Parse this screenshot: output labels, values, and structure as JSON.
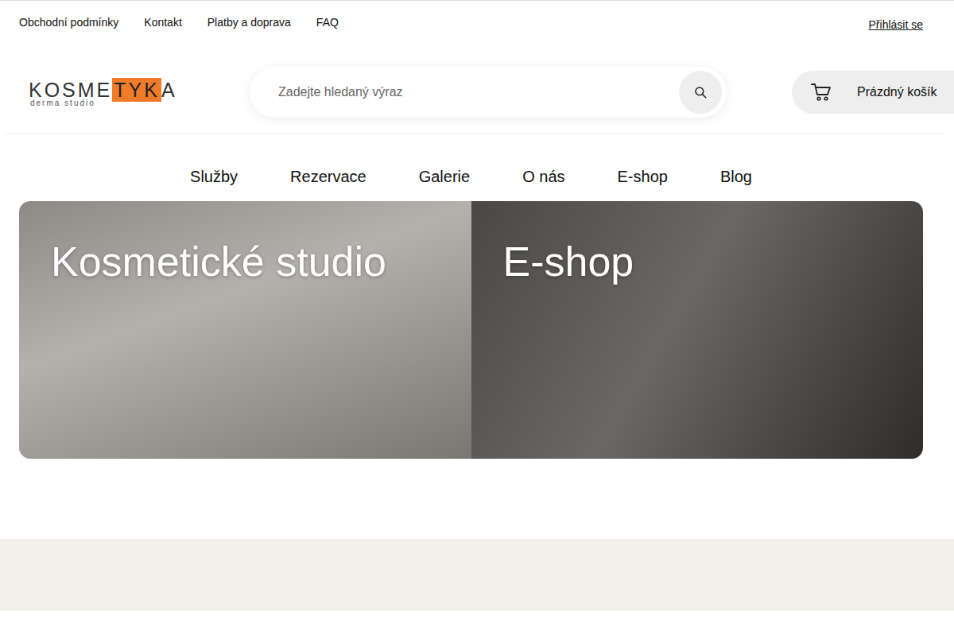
{
  "top_links": [
    "Obchodní podmínky",
    "Kontakt",
    "Platby a doprava",
    "FAQ"
  ],
  "login": "Přihlásit se",
  "logo": {
    "before": "KOSME",
    "highlight": "TYK",
    "after": "A",
    "tagline": "derma studio"
  },
  "search": {
    "placeholder": "Zadejte hledaný výraz"
  },
  "cart": {
    "label": "Prázdný košík"
  },
  "nav": [
    "Služby",
    "Rezervace",
    "Galerie",
    "O nás",
    "E-shop",
    "Blog"
  ],
  "hero_cards": [
    {
      "title": "Kosmetické studio"
    },
    {
      "title": "E-shop"
    }
  ]
}
